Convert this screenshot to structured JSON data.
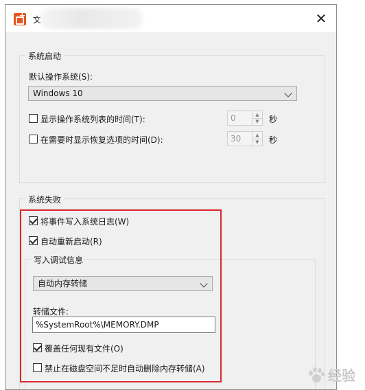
{
  "window": {
    "title": "文",
    "close_icon": "close-icon"
  },
  "startup": {
    "group_label": "系统启动",
    "default_os_label": "默认操作系统(S):",
    "default_os_value": "Windows 10",
    "show_list_label": "显示操作系统列表的时间(T):",
    "show_list_checked": false,
    "show_list_value": "0",
    "show_list_unit": "秒",
    "show_recovery_label": "在需要时显示恢复选项的时间(D):",
    "show_recovery_checked": false,
    "show_recovery_value": "30",
    "show_recovery_unit": "秒"
  },
  "failure": {
    "group_label": "系统失败",
    "write_event_label": "将事件写入系统日志(W)",
    "write_event_checked": true,
    "auto_restart_label": "自动重新启动(R)",
    "auto_restart_checked": true,
    "debug_group_label": "写入调试信息",
    "debug_type_value": "自动内存转储",
    "dump_file_label": "转储文件:",
    "dump_file_value": "%SystemRoot%\\MEMORY.DMP",
    "overwrite_label": "覆盖任何现有文件(O)",
    "overwrite_checked": true,
    "disable_auto_delete_label": "禁止在磁盘空间不足时自动删除内存转储(A)",
    "disable_auto_delete_checked": false
  },
  "watermark": {
    "text": "经验",
    "highlight_color": "#d9272d"
  }
}
